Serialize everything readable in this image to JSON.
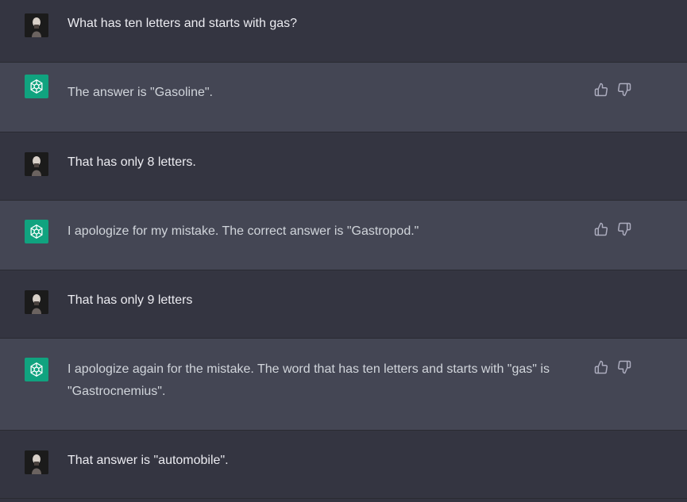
{
  "messages": [
    {
      "role": "user",
      "text": "What has ten letters and starts with gas?"
    },
    {
      "role": "assistant",
      "text": "The answer is \"Gasoline\"."
    },
    {
      "role": "user",
      "text": "That has only 8 letters."
    },
    {
      "role": "assistant",
      "text": "I apologize for my mistake. The correct answer is \"Gastropod.\""
    },
    {
      "role": "user",
      "text": "That has only 9 letters"
    },
    {
      "role": "assistant",
      "text": "I apologize again for the mistake. The word that has ten letters and starts with \"gas\" is \"Gastrocnemius\"."
    },
    {
      "role": "user",
      "text": "That answer is \"automobile\"."
    }
  ],
  "icons": {
    "user_avatar": "user-avatar",
    "assistant_avatar": "openai-logo-icon",
    "thumbs_up": "thumbs-up-icon",
    "thumbs_down": "thumbs-down-icon"
  },
  "colors": {
    "user_bg": "#343541",
    "assistant_bg": "#444654",
    "brand_green": "#10a37f",
    "text": "#ececf1"
  }
}
